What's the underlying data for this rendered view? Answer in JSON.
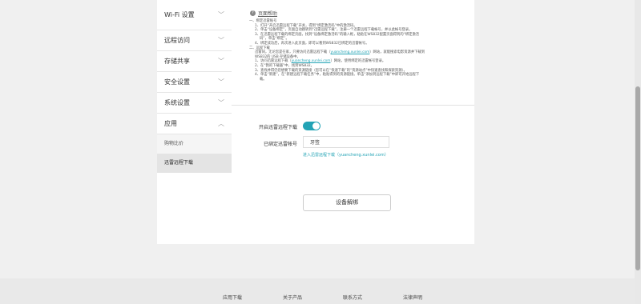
{
  "sidebar": {
    "items": [
      {
        "label": "Wi-Fi 设置"
      },
      {
        "label": "远程访问"
      },
      {
        "label": "存储共享"
      },
      {
        "label": "安全设置"
      },
      {
        "label": "系统设置"
      },
      {
        "label": "应用"
      }
    ],
    "sub_items": [
      {
        "label": "购物比价"
      },
      {
        "label": "迅雷远程下载"
      }
    ]
  },
  "help": {
    "title": "页面帮助",
    "lines": [
      "一、绑定迅雷账号",
      "1、打开“开启迅雷远程下载”开关，得到“绑定激活码”中的激活码。",
      "2、单击“设备绑定”，页面自动跳转到“迅雷远程下载”，注册一个迅雷远程下载帐号，并以此帐号登录。",
      "3、在迅雷远程下载的绑定页面，找到“设备绑定激活码”的输入框，粘贴在WS832配置页面得到的“绑定激活",
      "码”，单击“绑定”。",
      "4、绑定成功后，再次进入此页面，即可以看到WS832已绑定的迅雷帐号。",
      "二、远程下载",
      "迅雷同，无论您是在家，只要访问迅雷远程下载（",
      "）网站，就能搜索电影资源并下载到",
      "WS832的 USB 存储设备中。",
      "1、访问迅雷远程下载（",
      "）网站，使用绑定的迅雷帐号登录。",
      "2、在“我的下载器”中，找到WS832。",
      "3、查找并得仍您想要下载的资源链接（您可以在“快速下载”的“资源站点”中快速查找和探索资源）。",
      "4、单击“新建”，在“新建远程下载任务”中，粘贴得到的资源链接。单击“添加到远程下载”中即可开始远程下",
      "载。"
    ],
    "link_text": "yuancheng.xunlei.com"
  },
  "settings": {
    "toggle_label": "开启迅雷远程下载",
    "toggle_on": true,
    "account_label": "已绑定迅雷帐号",
    "account_value": "牙签",
    "enter_link": "进入迅雷远程下载（yuancheng.xunlei.com）",
    "unbind_button": "设备解绑"
  },
  "footer": {
    "links": [
      "应用下载",
      "关于产品",
      "联系方式",
      "法律声明"
    ]
  },
  "colors": {
    "accent": "#23a3b5",
    "page_bg": "#f0f0f0",
    "footer_bg": "#e9e9e9"
  }
}
